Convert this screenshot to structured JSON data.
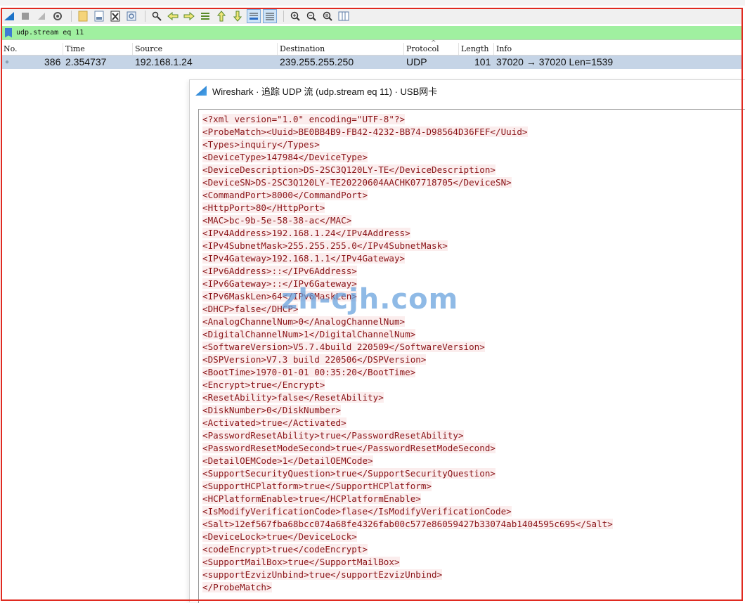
{
  "filter": {
    "value": "udp.stream eq 11"
  },
  "columns": {
    "no": "No.",
    "time": "Time",
    "source": "Source",
    "destination": "Destination",
    "protocol": "Protocol",
    "length": "Length",
    "info": "Info"
  },
  "packet": {
    "no": "386",
    "time": "2.354737",
    "source": "192.168.1.24",
    "destination": "239.255.255.250",
    "protocol": "UDP",
    "length": "101",
    "info": "37020 → 37020 Len=1539"
  },
  "dialog": {
    "title": "Wireshark · 追踪 UDP 流 (udp.stream eq 11) · USB网卡",
    "lines": [
      "<?xml version=\"1.0\" encoding=\"UTF-8\"?>",
      "<ProbeMatch><Uuid>BE0BB4B9-FB42-4232-BB74-D98564D36FEF</Uuid>",
      "<Types>inquiry</Types>",
      "<DeviceType>147984</DeviceType>",
      "<DeviceDescription>DS-2SC3Q120LY-TE</DeviceDescription>",
      "<DeviceSN>DS-2SC3Q120LY-TE20220604AACHK07718705</DeviceSN>",
      "<CommandPort>8000</CommandPort>",
      "<HttpPort>80</HttpPort>",
      "<MAC>bc-9b-5e-58-38-ac</MAC>",
      "<IPv4Address>192.168.1.24</IPv4Address>",
      "<IPv4SubnetMask>255.255.255.0</IPv4SubnetMask>",
      "<IPv4Gateway>192.168.1.1</IPv4Gateway>",
      "<IPv6Address>::</IPv6Address>",
      "<IPv6Gateway>::</IPv6Gateway>",
      "<IPv6MaskLen>64</IPv6MaskLen>",
      "<DHCP>false</DHCP>",
      "<AnalogChannelNum>0</AnalogChannelNum>",
      "<DigitalChannelNum>1</DigitalChannelNum>",
      "<SoftwareVersion>V5.7.4build 220509</SoftwareVersion>",
      "<DSPVersion>V7.3 build 220506</DSPVersion>",
      "<BootTime>1970-01-01 00:35:20</BootTime>",
      "<Encrypt>true</Encrypt>",
      "<ResetAbility>false</ResetAbility>",
      "<DiskNumber>0</DiskNumber>",
      "<Activated>true</Activated>",
      "<PasswordResetAbility>true</PasswordResetAbility>",
      "<PasswordResetModeSecond>true</PasswordResetModeSecond>",
      "<DetailOEMCode>1</DetailOEMCode>",
      "<SupportSecurityQuestion>true</SupportSecurityQuestion>",
      "<SupportHCPlatform>true</SupportHCPlatform>",
      "<HCPlatformEnable>true</HCPlatformEnable>",
      "<IsModifyVerificationCode>flase</IsModifyVerificationCode>",
      "<Salt>12ef567fba68bcc074a68fe4326fab00c577e86059427b33074ab1404595c695</Salt>",
      "<DeviceLock>true</DeviceLock>",
      "<codeEncrypt>true</codeEncrypt>",
      "<SupportMailBox>true</SupportMailBox>",
      "<supportEzvizUnbind>true</supportEzvizUnbind>",
      "</ProbeMatch>"
    ]
  },
  "watermark": "zh-cjh.com",
  "colors": {
    "filter_bg": "#a0f0a0",
    "selected_row": "#c5d4e6",
    "client_text": "#8a1418",
    "client_bg": "#fbeded",
    "highlight_frame": "#e02a20"
  },
  "toolbar_icons": [
    "shark-fin-start-icon",
    "stop-capture-icon",
    "restart-capture-icon",
    "capture-options-icon",
    "open-file-icon",
    "save-file-icon",
    "close-file-icon",
    "reload-icon",
    "find-packet-icon",
    "go-back-icon",
    "go-forward-icon",
    "go-to-packet-icon",
    "go-first-icon",
    "go-last-icon",
    "autoscroll-icon",
    "colorize-icon",
    "zoom-in-icon",
    "zoom-out-icon",
    "normal-size-icon",
    "resize-columns-icon"
  ]
}
